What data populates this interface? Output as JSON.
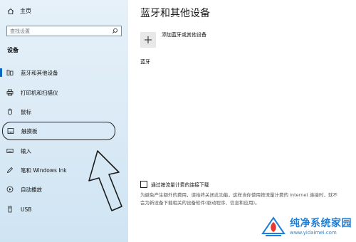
{
  "sidebar": {
    "home_label": "主页",
    "search_placeholder": "查找设置",
    "section_title": "设备",
    "items": [
      {
        "label": "蓝牙和其他设备",
        "icon": "bluetooth-devices-icon",
        "active": true
      },
      {
        "label": "打印机和扫描仪",
        "icon": "printer-icon"
      },
      {
        "label": "鼠标",
        "icon": "mouse-icon"
      },
      {
        "label": "触摸板",
        "icon": "touchpad-icon",
        "highlighted": true
      },
      {
        "label": "输入",
        "icon": "keyboard-icon"
      },
      {
        "label": "笔和 Windows Ink",
        "icon": "pen-icon"
      },
      {
        "label": "自动播放",
        "icon": "autoplay-icon"
      },
      {
        "label": "USB",
        "icon": "usb-icon"
      }
    ]
  },
  "main": {
    "title": "蓝牙和其他设备",
    "add_device_label": "添加蓝牙或其他设备",
    "bluetooth_label": "蓝牙",
    "metered_checkbox_label": "通过按流量计费的连接下载",
    "metered_description": "为避免产生额外的费用，请始终关闭此功能，这样当你使用按流量计费的 Internet 连接时，就不会为新设备下载相关的设备软件(驱动程序、信息和应用)。",
    "metered_checked": false
  },
  "watermark": {
    "name": "纯净系统家园",
    "url": "www.yidaimei.com"
  },
  "colors": {
    "accent": "#0a66c2",
    "sidebar_bg": "#dcebf6",
    "watermark": "#1f7fd6"
  }
}
